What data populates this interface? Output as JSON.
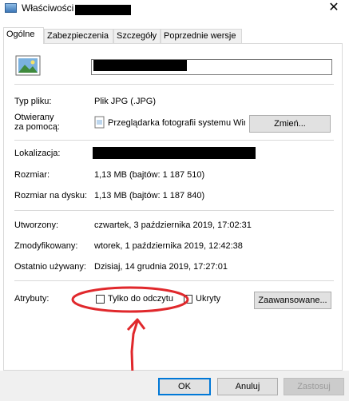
{
  "window": {
    "title": "Właściwości",
    "close_glyph": "✕"
  },
  "tabs": [
    {
      "label": "Ogólne"
    },
    {
      "label": "Zabezpieczenia"
    },
    {
      "label": "Szczegóły"
    },
    {
      "label": "Poprzednie wersje"
    }
  ],
  "general": {
    "file_type_label": "Typ pliku:",
    "file_type_value": "Plik JPG (.JPG)",
    "opens_with_label_1": "Otwierany",
    "opens_with_label_2": "za pomocą:",
    "opens_with_value": "Przeglądarka fotografii systemu Wir",
    "change_button": "Zmień...",
    "location_label": "Lokalizacja:",
    "size_label": "Rozmiar:",
    "size_value": "1,13 MB (bajtów: 1 187 510)",
    "size_on_disk_label": "Rozmiar na dysku:",
    "size_on_disk_value": "1,13 MB (bajtów: 1 187 840)",
    "created_label": "Utworzony:",
    "created_value": "czwartek, 3 października 2019, 17:02:31",
    "modified_label": "Zmodyfikowany:",
    "modified_value": "wtorek, 1 października 2019, 12:42:38",
    "accessed_label": "Ostatnio używany:",
    "accessed_value": "Dzisiaj, 14 grudnia 2019, 17:27:01",
    "attributes_label": "Atrybuty:",
    "readonly_label": "Tylko do odczytu",
    "hidden_label": "Ukryty",
    "advanced_button": "Zaawansowane..."
  },
  "footer": {
    "ok": "OK",
    "cancel": "Anuluj",
    "apply": "Zastosuj"
  },
  "colors": {
    "annotation_red": "#e0282c",
    "accent_blue": "#0078d7"
  }
}
